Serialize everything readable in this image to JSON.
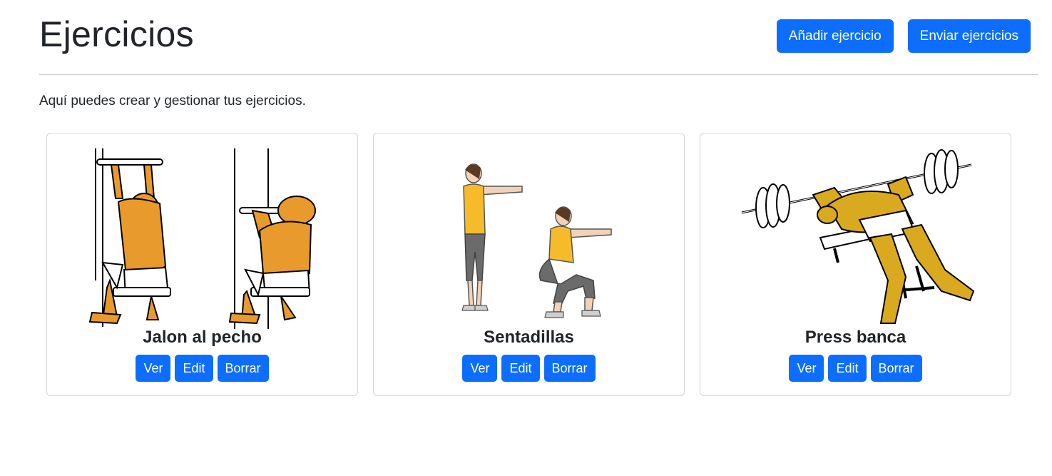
{
  "header": {
    "title": "Ejercicios",
    "add_button": "Añadir ejercicio",
    "send_button": "Enviar ejercicios"
  },
  "intro": "Aquí puedes crear y gestionar tus ejercicios.",
  "exercises": [
    {
      "name": "Jalon al pecho",
      "image": "lat-pulldown-illustration"
    },
    {
      "name": "Sentadillas",
      "image": "squat-illustration"
    },
    {
      "name": "Press banca",
      "image": "bench-press-illustration"
    }
  ],
  "card_actions": {
    "view": "Ver",
    "edit": "Edit",
    "delete": "Borrar"
  },
  "colors": {
    "primary": "#0d6efd",
    "muscle_orange": "#e99a2c",
    "muscle_gold": "#d9a920",
    "shirt_yellow": "#f5bb2b",
    "pants_gray": "#6b6b6b"
  }
}
